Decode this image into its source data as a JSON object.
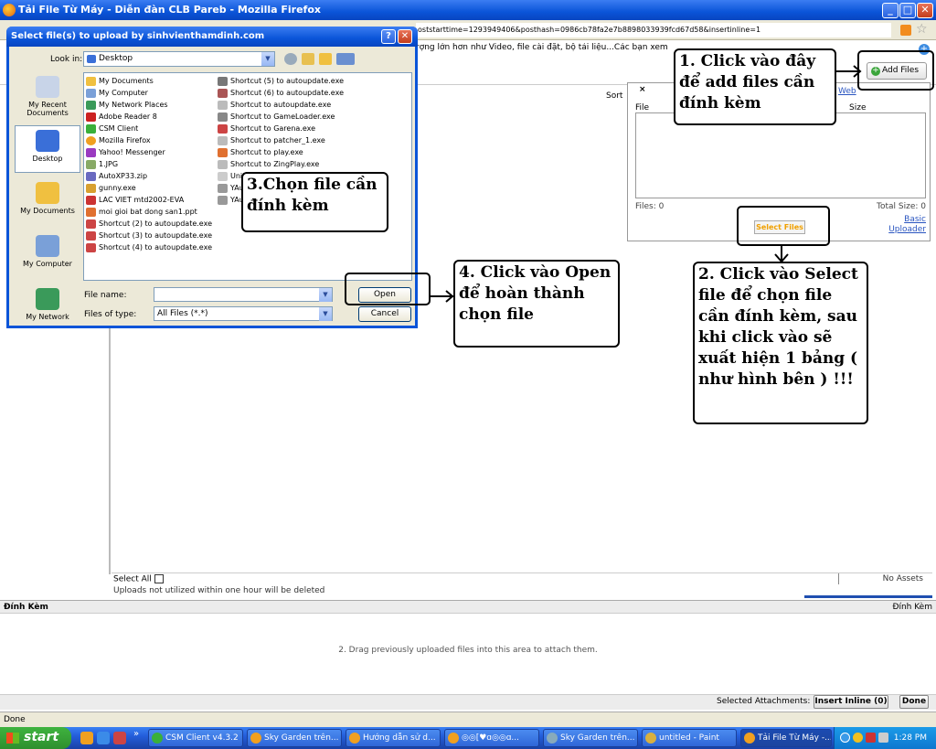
{
  "firefox": {
    "title": "Tải File Từ Máy - Diễn đàn CLB Pareb - Mozilla Firefox",
    "url_fragment": "oststarttime=1293949406&posthash=0986cb78fa2e7b8898033939fcd67d58&insertinline=1",
    "info_line": "rợng lớn hơn như Video, file cài đặt, bộ tải liệu...Các bạn xem"
  },
  "main": {
    "sort_label": "Sort",
    "select_all": "Select All",
    "uploads_note": "Uploads not utilized within one hour will be deleted",
    "no_assets": "No Assets"
  },
  "uploader": {
    "close": "×",
    "web": "Web",
    "col_file": "File",
    "col_size": "Size",
    "files_count": "Files: 0",
    "total_size": "Total Size: 0",
    "select_files": "Select Files",
    "basic_uploader": "Basic Uploader"
  },
  "add_files": "Add Files",
  "attach": {
    "header": "Đính Kèm",
    "header_right": "Đính Kèm",
    "drop_hint": "2. Drag previously uploaded files into this area to attach them.",
    "selected_attachments": "Selected Attachments:",
    "insert_inline": "Insert Inline (0)",
    "done": "Done"
  },
  "status": "Done",
  "dialog": {
    "title": "Select file(s) to upload by sinhvienthamdinh.com",
    "look_in_label": "Look in:",
    "look_in_value": "Desktop",
    "places": [
      "My Recent Documents",
      "Desktop",
      "My Documents",
      "My Computer",
      "My Network"
    ],
    "files_col1": [
      "My Documents",
      "My Computer",
      "My Network Places",
      "Adobe Reader 8",
      "CSM Client",
      "Mozilla Firefox",
      "Yahoo! Messenger",
      "1.JPG",
      "AutoXP33.zip",
      "gunny.exe",
      "LAC VIET mtd2002-EVA",
      "moi gioi bat dong san1.ppt",
      "Shortcut (2) to autoupdate.exe",
      "Shortcut (3) to autoupdate.exe",
      "Shortcut (4) to autoupdate.exe"
    ],
    "files_col2": [
      "Shortcut (5) to autoupdate.exe",
      "Shortcut (6) to autoupdate.exe",
      "Shortcut to autoupdate.exe",
      "Shortcut to GameLoader.exe",
      "Shortcut to Garena.exe",
      "Shortcut to patcher_1.exe",
      "Shortcut to play.exe",
      "Shortcut to ZingPlay.exe",
      "UniKey",
      "YAuto",
      "YAutoPl"
    ],
    "file_name_label": "File name:",
    "file_name_value": "",
    "file_type_label": "Files of type:",
    "file_type_value": "All Files (*.*)",
    "open": "Open",
    "cancel": "Cancel"
  },
  "annotations": {
    "a1": "1. Click vào đây để add files cần đính kèm",
    "a2": "2. Click vào Select file để chọn file cần đính kèm, sau khi click vào sẽ xuất hiện 1 bảng ( như hình bên ) !!!",
    "a3": "3.Chọn file cần đính kèm",
    "a4": "4. Click vào Open để hoàn thành chọn file"
  },
  "taskbar": {
    "start": "start",
    "tasks": [
      "CSM Client v4.3.2",
      "Sky Garden trên...",
      "Hướng dẫn sử d...",
      "◎◎[♥ɑ◎◎ɑ...",
      "Sky Garden trên...",
      "untitled - Paint",
      "Tải File Từ Máy -..."
    ],
    "clock": "1:28 PM"
  },
  "colors": {
    "xp_blue": "#0a54d8",
    "taskbar": "#245edb",
    "start_green": "#3fb33f",
    "select_files_text": "#f0a000",
    "link": "#2a55c0"
  }
}
